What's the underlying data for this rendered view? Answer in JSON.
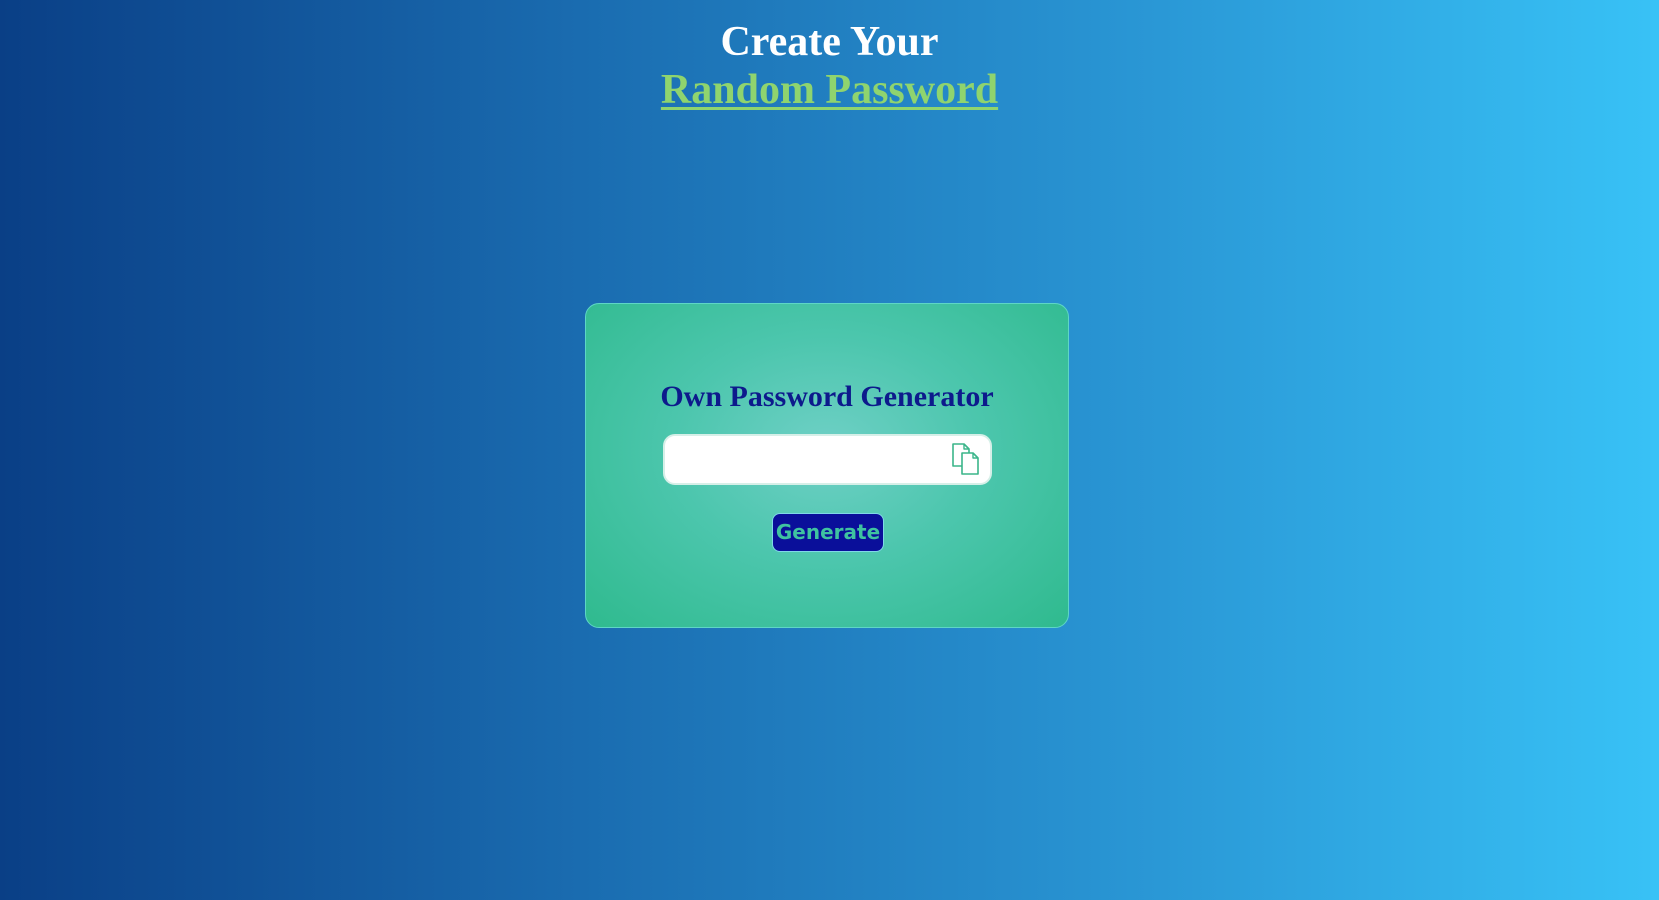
{
  "header": {
    "title_line1": "Create Your",
    "title_line2": "Random Password"
  },
  "generator": {
    "title": "Own Password Generator",
    "password_value": "",
    "copy_icon": "copy-icon",
    "generate_label": "Generate"
  },
  "colors": {
    "background_start": "#0a3f86",
    "background_end": "#38c2f6",
    "title_white": "#ffffff",
    "title_accent": "#8fd46e",
    "card_green": "#3cc09a",
    "card_title": "#0d1a8c",
    "button_bg": "#0a0f9a",
    "button_text": "#3fc3a0",
    "icon_stroke": "#3bb58a"
  }
}
